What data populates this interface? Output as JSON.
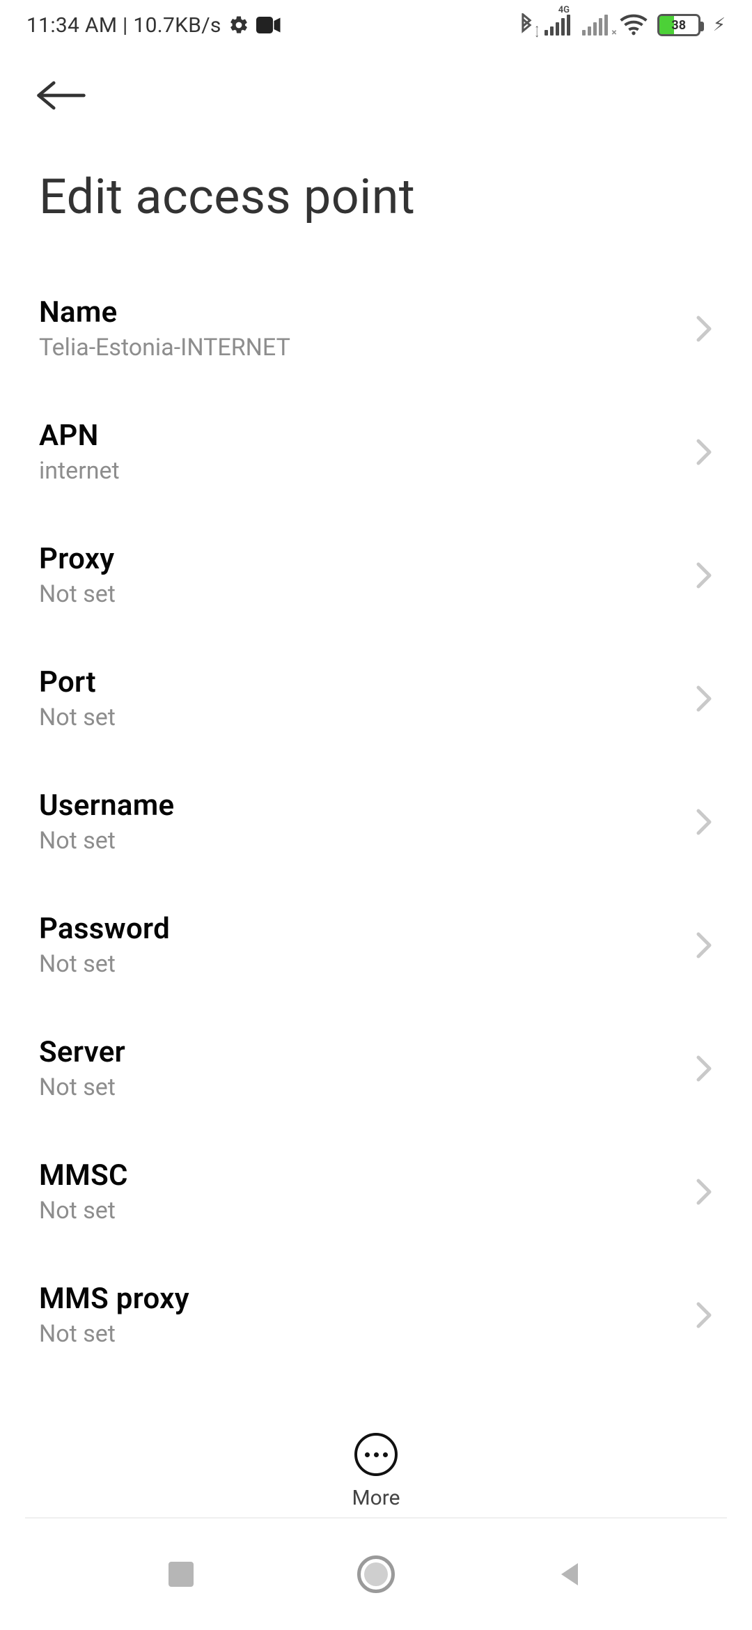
{
  "status": {
    "time": "11:34 AM",
    "net_speed": "10.7KB/s",
    "signal1_label": "4G",
    "battery_pct": "38"
  },
  "page_title": "Edit access point",
  "fields": {
    "name": {
      "label": "Name",
      "value": "Telia-Estonia-INTERNET"
    },
    "apn": {
      "label": "APN",
      "value": "internet"
    },
    "proxy": {
      "label": "Proxy",
      "value": "Not set"
    },
    "port": {
      "label": "Port",
      "value": "Not set"
    },
    "username": {
      "label": "Username",
      "value": "Not set"
    },
    "password": {
      "label": "Password",
      "value": "Not set"
    },
    "server": {
      "label": "Server",
      "value": "Not set"
    },
    "mmsc": {
      "label": "MMSC",
      "value": "Not set"
    },
    "mms_proxy": {
      "label": "MMS proxy",
      "value": "Not set"
    }
  },
  "more_label": "More"
}
